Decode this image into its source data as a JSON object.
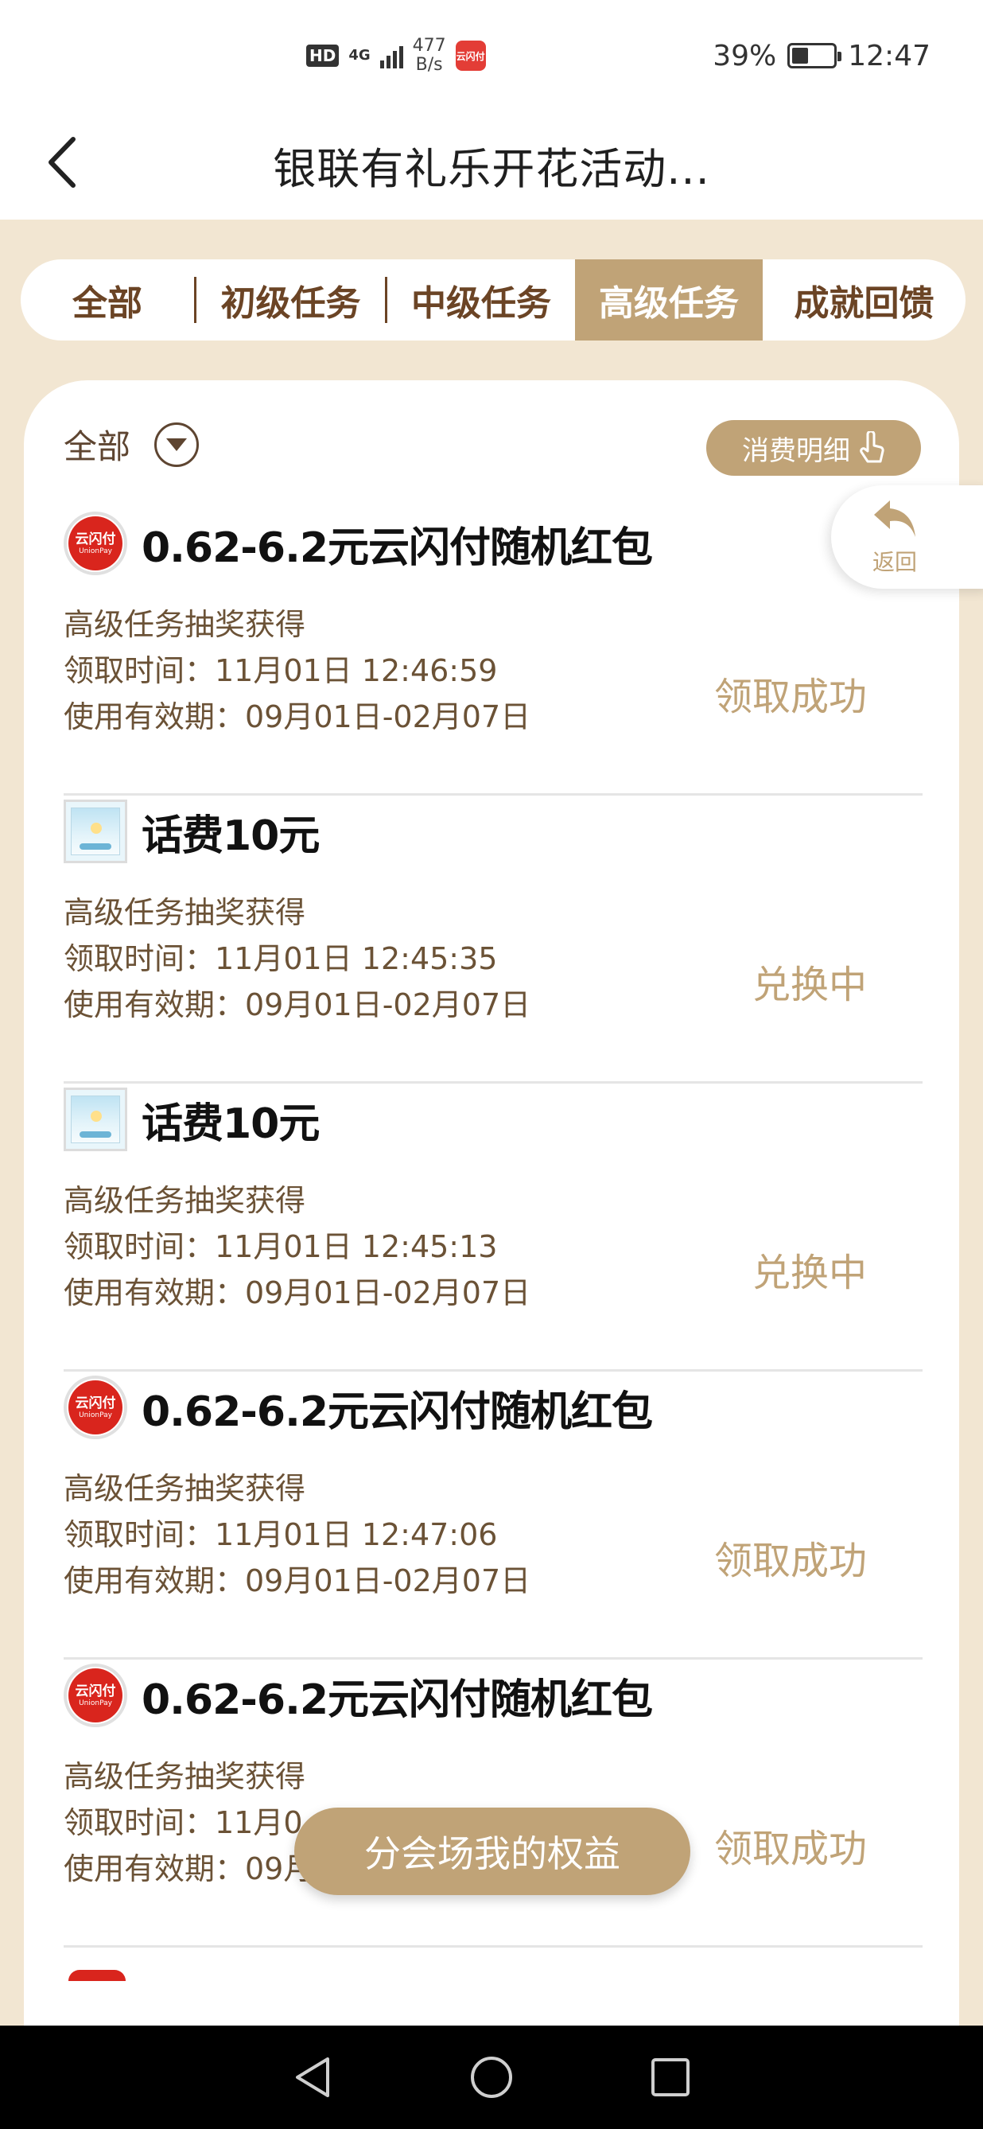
{
  "status_bar": {
    "hd": "HD",
    "network": "4G",
    "speed_value": "477",
    "speed_unit": "B/s",
    "app_badge": "云闪付",
    "battery": "39%",
    "battery_level": 0.39,
    "time": "12:47"
  },
  "header": {
    "title": "银联有礼乐开花活动..."
  },
  "tabs": [
    {
      "label": "全部",
      "active": false
    },
    {
      "label": "初级任务",
      "active": false
    },
    {
      "label": "中级任务",
      "active": false
    },
    {
      "label": "高级任务",
      "active": true
    },
    {
      "label": "成就回馈",
      "active": false
    }
  ],
  "filter": {
    "label": "全部"
  },
  "detail_button": {
    "label": "消费明细"
  },
  "return_button": {
    "label": "返回"
  },
  "logo_text": {
    "unionpay_cn": "云闪付",
    "unionpay_en": "UnionPay"
  },
  "items": [
    {
      "logo": "unionpay",
      "title": "0.62-6.2元云闪付随机红包",
      "source": "高级任务抽奖获得",
      "receive_time": "领取时间：11月01日 12:46:59",
      "validity": "使用有效期：09月01日-02月07日",
      "status": "领取成功"
    },
    {
      "logo": "voucher",
      "title": "话费10元",
      "source": "高级任务抽奖获得",
      "receive_time": "领取时间：11月01日 12:45:35",
      "validity": "使用有效期：09月01日-02月07日",
      "status": "兑换中"
    },
    {
      "logo": "voucher",
      "title": "话费10元",
      "source": "高级任务抽奖获得",
      "receive_time": "领取时间：11月01日 12:45:13",
      "validity": "使用有效期：09月01日-02月07日",
      "status": "兑换中"
    },
    {
      "logo": "unionpay",
      "title": "0.62-6.2元云闪付随机红包",
      "source": "高级任务抽奖获得",
      "receive_time": "领取时间：11月01日 12:47:06",
      "validity": "使用有效期：09月01日-02月07日",
      "status": "领取成功"
    },
    {
      "logo": "unionpay",
      "title": "0.62-6.2元云闪付随机红包",
      "source": "高级任务抽奖获得",
      "receive_time": "领取时间：11月0",
      "validity": "使用有效期：09月",
      "status": "领取成功"
    }
  ],
  "floating_button": {
    "label": "分会场我的权益"
  },
  "colors": {
    "accent": "#c0a377",
    "brown": "#6b4425",
    "background": "#f2e6d2",
    "brand_red": "#d9251d"
  }
}
